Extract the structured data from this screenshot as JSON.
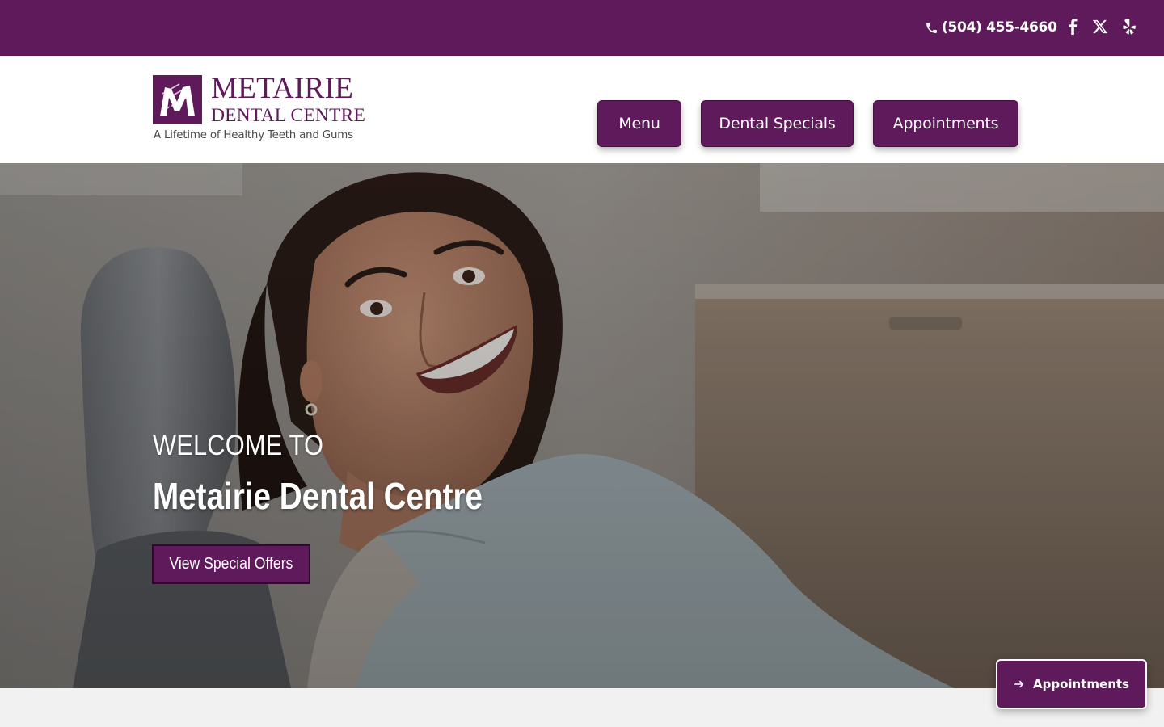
{
  "colors": {
    "brand_purple": "#5f1a5c",
    "white": "#ffffff",
    "page_bg": "#f1f1f1"
  },
  "topbar": {
    "phone_icon": "phone-icon",
    "phone": "(504) 455-4660",
    "social": [
      {
        "name": "facebook-icon"
      },
      {
        "name": "x-twitter-icon"
      },
      {
        "name": "yelp-icon"
      }
    ]
  },
  "logo": {
    "name_line1": "METAIRIE",
    "name_line2": "DENTAL CENTRE",
    "tagline": "A Lifetime of Healthy Teeth and Gums"
  },
  "nav": {
    "menu": "Menu",
    "specials": "Dental Specials",
    "appointments": "Appointments"
  },
  "hero": {
    "welcome": "WELCOME TO",
    "title": "Metairie Dental Centre",
    "cta": "View Special Offers"
  },
  "floating": {
    "icon": "arrow-right-icon",
    "label": "Appointments"
  }
}
